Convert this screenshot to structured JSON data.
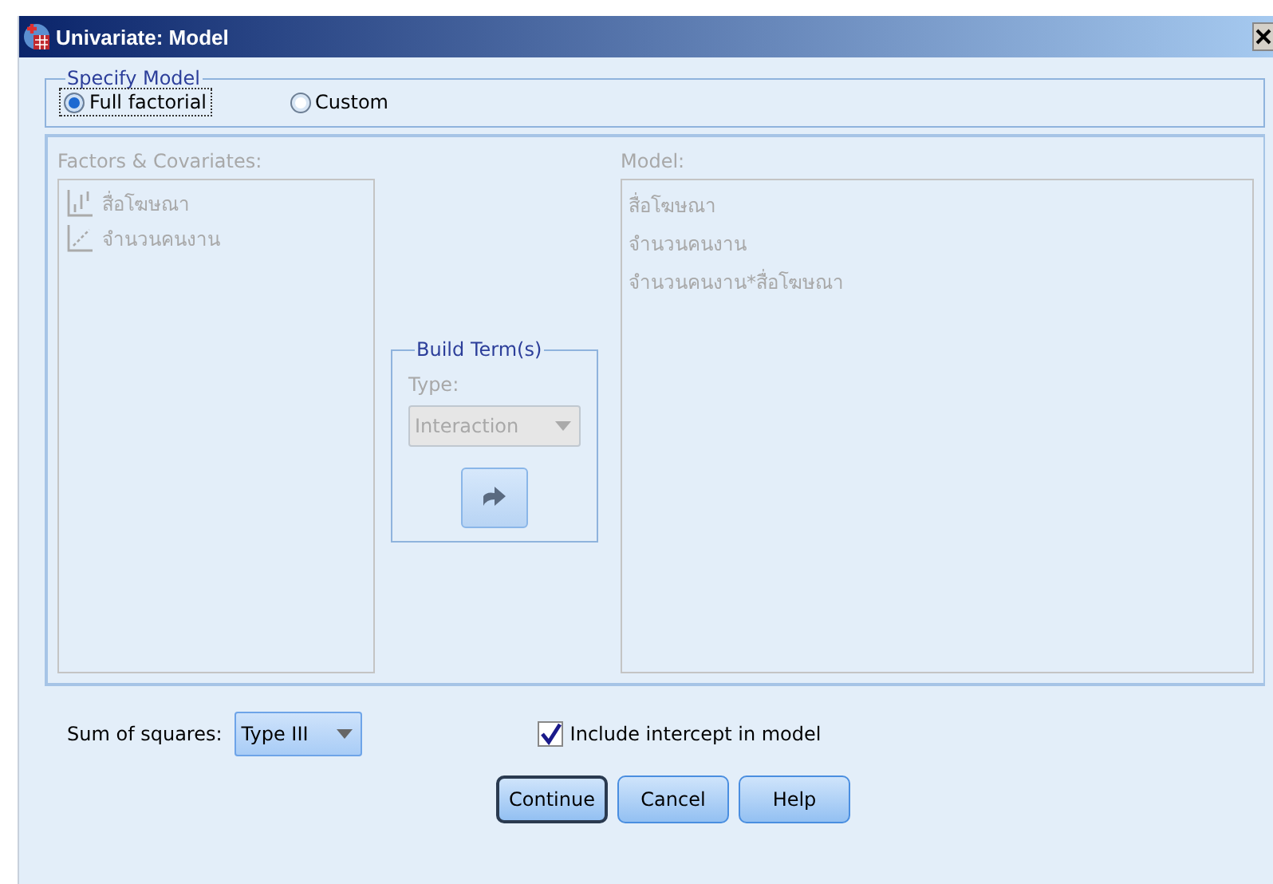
{
  "window": {
    "title": "Univariate: Model"
  },
  "specify_model": {
    "title": "Specify Model",
    "options": [
      {
        "label": "Full factorial",
        "selected": true
      },
      {
        "label": "Custom",
        "selected": false
      }
    ]
  },
  "terms": {
    "disabled": true,
    "factors_label": "Factors & Covariates:",
    "factors": [
      {
        "name": "สื่อโฆษณา",
        "kind": "nominal"
      },
      {
        "name": "จำนวนคนงาน",
        "kind": "scale"
      }
    ],
    "build": {
      "title": "Build Term(s)",
      "type_label": "Type:",
      "type_value": "Interaction"
    },
    "model_label": "Model:",
    "model": [
      "สื่อโฆษณา",
      "จำนวนคนงาน",
      "จำนวนคนงาน*สื่อโฆษณา"
    ]
  },
  "sum_of_squares": {
    "label": "Sum of squares:",
    "value": "Type III"
  },
  "include_intercept": {
    "label": "Include intercept in model",
    "checked": true
  },
  "buttons": [
    {
      "label": "Continue",
      "default": true
    },
    {
      "label": "Cancel",
      "default": false
    },
    {
      "label": "Help",
      "default": false
    }
  ]
}
